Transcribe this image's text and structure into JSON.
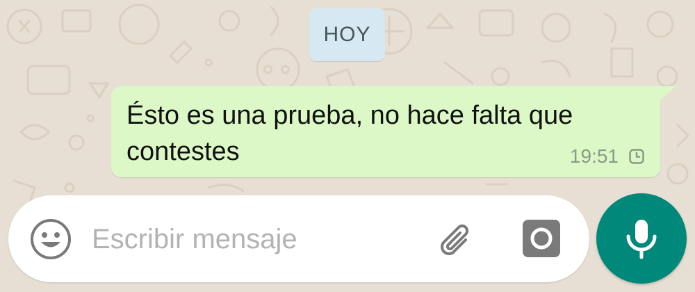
{
  "chat": {
    "date_chip": "HOY",
    "messages": [
      {
        "text": "Ésto es una prueba, no hace falta que contestes",
        "time": "19:51",
        "status_icon": "clock-icon"
      }
    ]
  },
  "composer": {
    "placeholder": "Escribir mensaje",
    "value": "",
    "icons": [
      "emoji-icon",
      "paperclip-icon",
      "camera-icon",
      "microphone-icon"
    ]
  },
  "colors": {
    "wallpaper": "#e8dfd4",
    "outgoing_bubble": "#dcf8c6",
    "date_chip": "#d6e9f3",
    "accent": "#00897b",
    "icon_gray": "#7a7a7a"
  }
}
